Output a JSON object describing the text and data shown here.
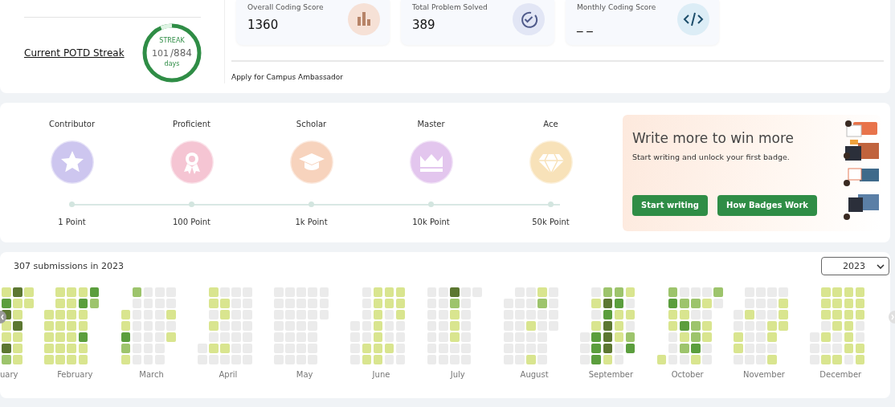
{
  "profile": {
    "streak_label": "Current POTD Streak",
    "streak": {
      "title": "STREAK",
      "current": "101",
      "total": "/884",
      "unit": "days"
    }
  },
  "stats": [
    {
      "label": "Overall Coding Score",
      "value": "1360",
      "kind": "bars"
    },
    {
      "label": "Total Problem Solved",
      "value": "389",
      "kind": "check"
    },
    {
      "label": "Monthly Coding Score",
      "value": "_ _",
      "kind": "code"
    }
  ],
  "campus_link": "Apply for Campus Ambassador",
  "badges": [
    {
      "name": "Contributor",
      "points": "1 Point",
      "kind": "star",
      "color": "#cdc6ef"
    },
    {
      "name": "Proficient",
      "points": "100 Point",
      "kind": "ribbon",
      "color": "#f5c5d3"
    },
    {
      "name": "Scholar",
      "points": "1k Point",
      "kind": "cap",
      "color": "#f7d3bd"
    },
    {
      "name": "Master",
      "points": "10k Point",
      "kind": "crown",
      "color": "#e3c6ee"
    },
    {
      "name": "Ace",
      "points": "50k Point",
      "kind": "diamond",
      "color": "#f8e2b9"
    }
  ],
  "promo": {
    "title": "Write more to win more",
    "subtitle": "Start writing and unlock your first badge.",
    "buttons": [
      "Start writing",
      "How Badges Work"
    ]
  },
  "submissions": {
    "summary": "307 submissions in 2023",
    "year": "2023",
    "months": [
      "uary",
      "February",
      "March",
      "April",
      "May",
      "June",
      "July",
      "August",
      "September",
      "October",
      "November",
      "December"
    ]
  }
}
